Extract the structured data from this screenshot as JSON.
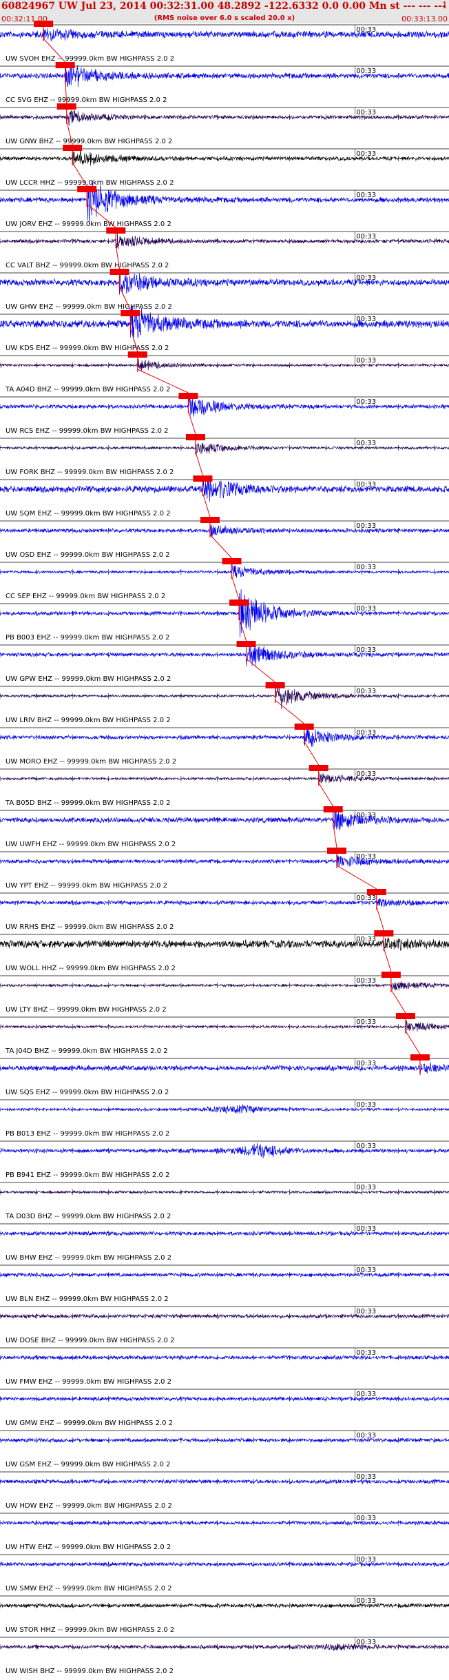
{
  "header": {
    "title": "60824967 UW Jul 23, 2014 00:32:31.00   48.2892 -122.6332  0.0 0.00 Mn st --- --- ---",
    "right_text": "1",
    "start_time": "00:32:11.00",
    "rms_note": "(RMS noise over 6.0 s scaled 20.0 x)",
    "end_time": "00:33:13.00"
  },
  "colors": {
    "blue": "#0000ee",
    "black": "#000000",
    "navy": "#220055",
    "pick": "#ee0000"
  },
  "chart_data": {
    "type": "line",
    "time_start_s": 0,
    "time_end_s": 62,
    "time_mark_label": "00:33",
    "time_mark_s": 49,
    "channels": [
      {
        "label": "UW SVOH EHZ -- 99999.0km BW  HIGHPASS  2.0  2",
        "color": "blue",
        "pick_s": 6.0,
        "amp": 0.5,
        "event": 0.4
      },
      {
        "label": "CC SVG EHZ -- 99999.0km BW  HIGHPASS  2.0  2",
        "color": "blue",
        "pick_s": 9.0,
        "amp": 0.4,
        "event": 1.0
      },
      {
        "label": "UW GNW BHZ -- 99999.0km BW  HIGHPASS  2.0  2",
        "color": "navy",
        "pick_s": 9.2,
        "amp": 0.3,
        "event": 0.5
      },
      {
        "label": "UW LCCR HHZ -- 99999.0km BW  HIGHPASS  2.0  2",
        "color": "black",
        "pick_s": 10.0,
        "amp": 0.3,
        "event": 0.7
      },
      {
        "label": "UW JORV EHZ -- 99999.0km BW  HIGHPASS  2.0  2",
        "color": "blue",
        "pick_s": 12.0,
        "amp": 0.4,
        "event": 1.6
      },
      {
        "label": "CC VALT BHZ -- 99999.0km BW  HIGHPASS  2.0  2",
        "color": "navy",
        "pick_s": 16.0,
        "amp": 0.3,
        "event": 0.5
      },
      {
        "label": "UW GHW EHZ -- 99999.0km BW  HIGHPASS  2.0  2",
        "color": "blue",
        "pick_s": 16.5,
        "amp": 0.5,
        "event": 0.9
      },
      {
        "label": "UW KDS EHZ -- 99999.0km BW  HIGHPASS  2.0  2",
        "color": "blue",
        "pick_s": 18.0,
        "amp": 0.6,
        "event": 1.3
      },
      {
        "label": "TA A04D BHZ -- 99999.0km BW  HIGHPASS  2.0  2",
        "color": "navy",
        "pick_s": 19.0,
        "amp": 0.2,
        "event": 0.4
      },
      {
        "label": "UW RCS EHZ -- 99999.0km BW  HIGHPASS  2.0  2",
        "color": "blue",
        "pick_s": 26.0,
        "amp": 0.3,
        "event": 0.9
      },
      {
        "label": "UW FORK BHZ -- 99999.0km BW  HIGHPASS  2.0  2",
        "color": "navy",
        "pick_s": 27.0,
        "amp": 0.2,
        "event": 0.5
      },
      {
        "label": "UW SQM EHZ -- 99999.0km BW  HIGHPASS  2.0  2",
        "color": "blue",
        "pick_s": 28.0,
        "amp": 0.5,
        "event": 1.0
      },
      {
        "label": "UW OSD EHZ -- 99999.0km BW  HIGHPASS  2.0  2",
        "color": "blue",
        "pick_s": 29.0,
        "amp": 0.3,
        "event": 0.4
      },
      {
        "label": "CC SEP EHZ -- 99999.0km BW  HIGHPASS  2.0  2",
        "color": "blue",
        "pick_s": 32.0,
        "amp": 0.2,
        "event": 0.5
      },
      {
        "label": "PB B003 EHZ -- 99999.0km BW  HIGHPASS  2.0  2",
        "color": "blue",
        "pick_s": 33.0,
        "amp": 0.3,
        "event": 1.6
      },
      {
        "label": "UW GPW EHZ -- 99999.0km BW  HIGHPASS  2.0  2",
        "color": "blue",
        "pick_s": 34.0,
        "amp": 0.3,
        "event": 0.9
      },
      {
        "label": "UW LRIV BHZ -- 99999.0km BW  HIGHPASS  2.0  2",
        "color": "navy",
        "pick_s": 38.0,
        "amp": 0.2,
        "event": 1.0
      },
      {
        "label": "UW MORO EHZ -- 99999.0km BW  HIGHPASS  2.0  2",
        "color": "blue",
        "pick_s": 42.0,
        "amp": 0.3,
        "event": 0.7
      },
      {
        "label": "TA B05D BHZ -- 99999.0km BW  HIGHPASS  2.0  2",
        "color": "navy",
        "pick_s": 44.0,
        "amp": 0.2,
        "event": 0.4
      },
      {
        "label": "UW UWFH EHZ -- 99999.0km BW  HIGHPASS  2.0  2",
        "color": "blue",
        "pick_s": 46.0,
        "amp": 0.4,
        "event": 0.8
      },
      {
        "label": "UW YPT EHZ -- 99999.0km BW  HIGHPASS  2.0  2",
        "color": "blue",
        "pick_s": 46.5,
        "amp": 0.3,
        "event": 0.5
      },
      {
        "label": "UW RRHS EHZ -- 99999.0km BW  HIGHPASS  2.0  2",
        "color": "blue",
        "pick_s": 52.0,
        "amp": 0.3,
        "event": 0.3
      },
      {
        "label": "UW WOLL HHZ -- 99999.0km BW  HIGHPASS  2.0  2",
        "color": "black",
        "pick_s": 53.0,
        "amp": 0.6,
        "event": 0.3
      },
      {
        "label": "UW LTY BHZ -- 99999.0km BW  HIGHPASS  2.0  2",
        "color": "navy",
        "pick_s": 54.0,
        "amp": 0.2,
        "event": 0.4
      },
      {
        "label": "TA J04D BHZ -- 99999.0km BW  HIGHPASS  2.0  2",
        "color": "navy",
        "pick_s": 56.0,
        "amp": 0.2,
        "event": 0.4
      },
      {
        "label": "UW SQS EHZ -- 99999.0km BW  HIGHPASS  2.0  2",
        "color": "blue",
        "pick_s": 58.0,
        "amp": 0.4,
        "event": 0.3
      },
      {
        "label": "PB B013 EHZ -- 99999.0km BW  HIGHPASS  2.0  2",
        "color": "blue",
        "pick_s": null,
        "amp": 0.2,
        "event": 0.6
      },
      {
        "label": "PB B941 EHZ -- 99999.0km BW  HIGHPASS  2.0  2",
        "color": "blue",
        "pick_s": null,
        "amp": 0.3,
        "event": 0.9
      },
      {
        "label": "TA D03D BHZ -- 99999.0km BW  HIGHPASS  2.0  2",
        "color": "navy",
        "pick_s": null,
        "amp": 0.2,
        "event": 0.0
      },
      {
        "label": "UW BHW EHZ -- 99999.0km BW  HIGHPASS  2.0  2",
        "color": "blue",
        "pick_s": null,
        "amp": 0.3,
        "event": 0.0
      },
      {
        "label": "UW BLN EHZ -- 99999.0km BW  HIGHPASS  2.0  2",
        "color": "blue",
        "pick_s": null,
        "amp": 0.3,
        "event": 0.0
      },
      {
        "label": "UW DOSE BHZ -- 99999.0km BW  HIGHPASS  2.0  2",
        "color": "navy",
        "pick_s": null,
        "amp": 0.3,
        "event": 0.0
      },
      {
        "label": "UW FMW EHZ -- 99999.0km BW  HIGHPASS  2.0  2",
        "color": "blue",
        "pick_s": null,
        "amp": 0.3,
        "event": 0.0
      },
      {
        "label": "UW GMW EHZ -- 99999.0km BW  HIGHPASS  2.0  2",
        "color": "blue",
        "pick_s": null,
        "amp": 0.3,
        "event": 0.0
      },
      {
        "label": "UW GSM EHZ -- 99999.0km BW  HIGHPASS  2.0  2",
        "color": "blue",
        "pick_s": null,
        "amp": 0.3,
        "event": 0.0
      },
      {
        "label": "UW HDW EHZ -- 99999.0km BW  HIGHPASS  2.0  2",
        "color": "blue",
        "pick_s": null,
        "amp": 0.3,
        "event": 0.0
      },
      {
        "label": "UW HTW EHZ -- 99999.0km BW  HIGHPASS  2.0  2",
        "color": "blue",
        "pick_s": null,
        "amp": 0.3,
        "event": 0.0
      },
      {
        "label": "UW SMW EHZ -- 99999.0km BW  HIGHPASS  2.0  2",
        "color": "blue",
        "pick_s": null,
        "amp": 0.3,
        "event": 0.0
      },
      {
        "label": "UW STOR HHZ -- 99999.0km BW  HIGHPASS  2.0  2",
        "color": "black",
        "pick_s": null,
        "amp": 0.3,
        "event": 0.0
      },
      {
        "label": "UW WISH BHZ -- 99999.0km BW  HIGHPASS  2.0  2",
        "color": "navy",
        "pick_s": null,
        "amp": 0.3,
        "event": 0.4
      }
    ]
  }
}
